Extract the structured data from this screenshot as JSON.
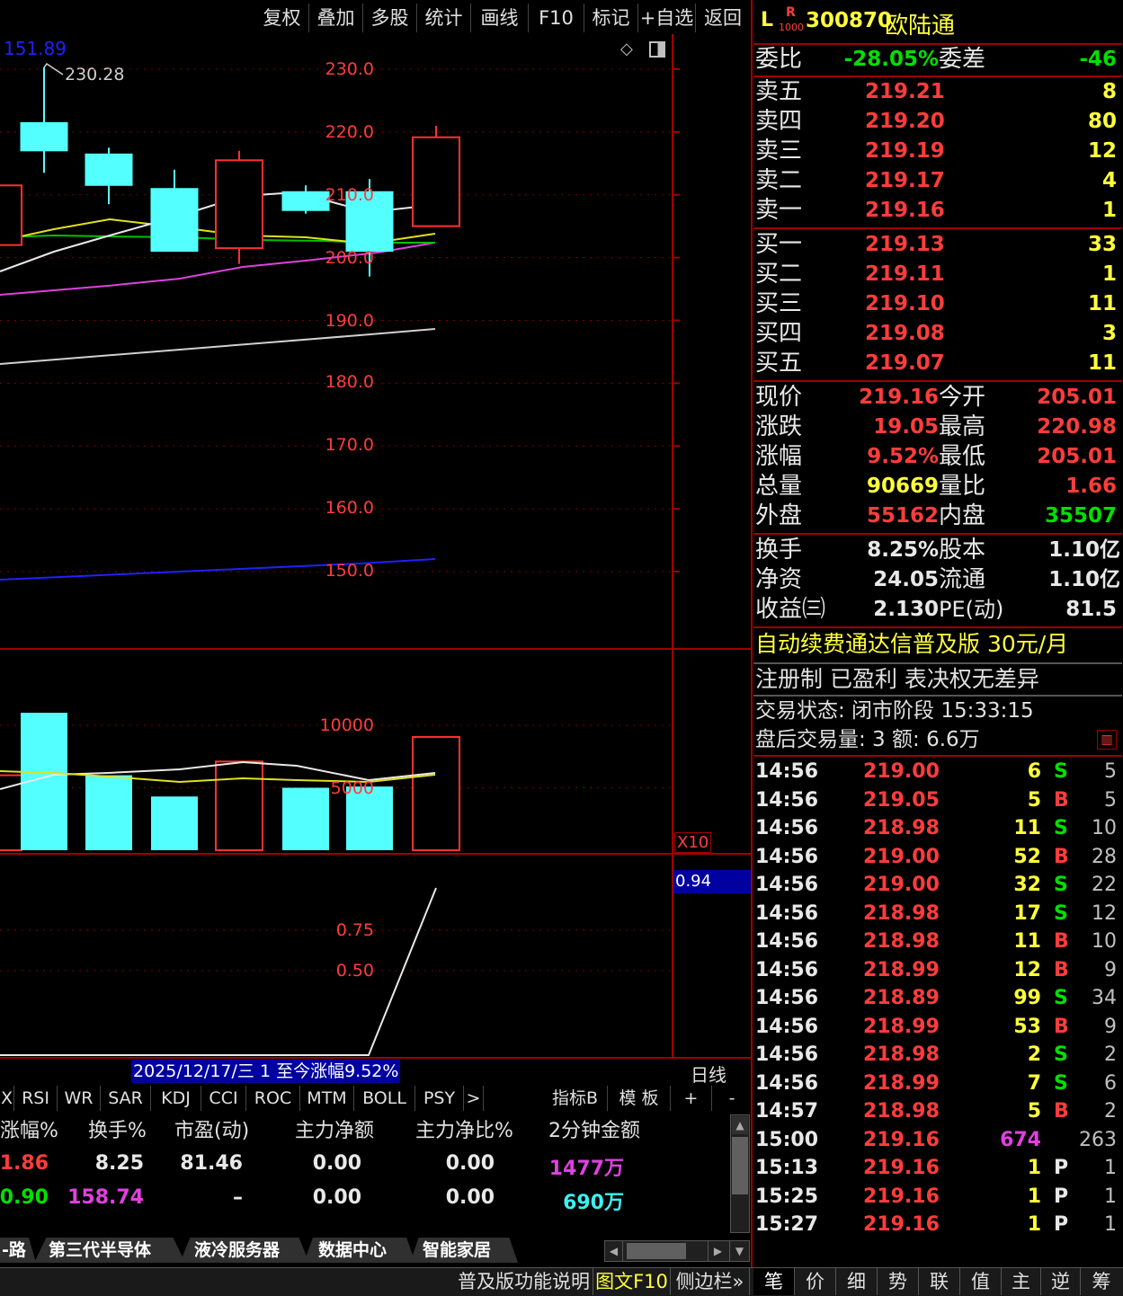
{
  "toolbar": {
    "items": [
      "复权",
      "叠加",
      "多股",
      "统计",
      "画线",
      "F10",
      "标记",
      "+自选",
      "返回"
    ]
  },
  "chart": {
    "ma_label": "151.89",
    "high_label": "230.28",
    "price_axis": [
      "230.0",
      "220.0",
      "210.0",
      "200.0",
      "190.0",
      "180.0",
      "170.0",
      "160.0",
      "150.0"
    ],
    "volume_axis": [
      "10000",
      "5000"
    ],
    "volume_unit": "X10",
    "ind_axis": [
      "0.94",
      "0.75",
      "0.50"
    ],
    "status_bar": "2025/12/17/三 1 至今涨幅9.52%",
    "period": "日线"
  },
  "chart_data": {
    "type": "candlestick",
    "ylim": [
      145,
      234
    ],
    "candles": [
      {
        "open": 211.5,
        "close": 202,
        "high": 215,
        "low": 199,
        "color": "red"
      },
      {
        "open": 221.5,
        "close": 217,
        "high": 230.28,
        "low": 213.5,
        "color": "cyan"
      },
      {
        "open": 216.5,
        "close": 211.5,
        "high": 217.5,
        "low": 208.5,
        "color": "cyan"
      },
      {
        "open": 211,
        "close": 201,
        "high": 214,
        "low": 201,
        "color": "cyan"
      },
      {
        "open": 201.5,
        "close": 215.5,
        "high": 217,
        "low": 199,
        "color": "red"
      },
      {
        "open": 210.5,
        "close": 207.5,
        "high": 211.5,
        "low": 207,
        "color": "cyan"
      },
      {
        "open": 210.5,
        "close": 201,
        "high": 212.5,
        "low": 197,
        "color": "cyan"
      },
      {
        "open": 205.01,
        "close": 219.16,
        "high": 220.98,
        "low": 205.01,
        "color": "red"
      }
    ],
    "volume": [
      {
        "value": 6000,
        "color": "red"
      },
      {
        "value": 11000,
        "color": "cyan"
      },
      {
        "value": 6000,
        "color": "cyan"
      },
      {
        "value": 4300,
        "color": "cyan"
      },
      {
        "value": 7100,
        "color": "red"
      },
      {
        "value": 5000,
        "color": "cyan"
      },
      {
        "value": 5100,
        "color": "cyan"
      },
      {
        "value": 9066.9,
        "color": "red"
      }
    ]
  },
  "indicator_tabs": [
    "X",
    "RSI",
    "WR",
    "SAR",
    "KDJ",
    "CCI",
    "ROC",
    "MTM",
    "BOLL",
    "PSY",
    ">",
    "指标B",
    "模 板",
    "+",
    "-"
  ],
  "table": {
    "headers": [
      "涨幅%",
      "换手%",
      "市盈(动)",
      "主力净额",
      "主力净比%",
      "2分钟金额"
    ],
    "rows": [
      [
        "1.86",
        "8.25",
        "81.46",
        "0.00",
        "0.00",
        "1477万"
      ],
      [
        "-0.90",
        "158.74",
        "–",
        "0.00",
        "0.00",
        "690万"
      ]
    ]
  },
  "sector_tabs": [
    "-路",
    "第三代半导体",
    "液冷服务器",
    "数据中心",
    "智能家居"
  ],
  "bottom_bar": [
    "普及版功能说明",
    "图文F10",
    "侧边栏»"
  ],
  "quote": {
    "market_tag": "L",
    "badge": "R",
    "badge_sub": "1000",
    "code": "300870",
    "name": "欧陆通",
    "weibi_label": "委比",
    "weibi": "-28.05%",
    "weicha_label": "委差",
    "weicha": "-46",
    "sells": [
      {
        "label": "卖五",
        "price": "219.21",
        "vol": "8"
      },
      {
        "label": "卖四",
        "price": "219.20",
        "vol": "80"
      },
      {
        "label": "卖三",
        "price": "219.19",
        "vol": "12"
      },
      {
        "label": "卖二",
        "price": "219.17",
        "vol": "4"
      },
      {
        "label": "卖一",
        "price": "219.16",
        "vol": "1"
      }
    ],
    "buys": [
      {
        "label": "买一",
        "price": "219.13",
        "vol": "33"
      },
      {
        "label": "买二",
        "price": "219.11",
        "vol": "1"
      },
      {
        "label": "买三",
        "price": "219.10",
        "vol": "11"
      },
      {
        "label": "买四",
        "price": "219.08",
        "vol": "3"
      },
      {
        "label": "买五",
        "price": "219.07",
        "vol": "11"
      }
    ],
    "stats": [
      {
        "l1": "现价",
        "v1": "219.16",
        "l2": "今开",
        "v2": "205.01"
      },
      {
        "l1": "涨跌",
        "v1": "19.05",
        "l2": "最高",
        "v2": "220.98"
      },
      {
        "l1": "涨幅",
        "v1": "9.52%",
        "l2": "最低",
        "v2": "205.01"
      },
      {
        "l1": "总量",
        "v1": "90669",
        "l2": "量比",
        "v2": "1.66"
      },
      {
        "l1": "外盘",
        "v1": "55162",
        "l2": "内盘",
        "v2": "35507"
      }
    ],
    "stats2": [
      {
        "l1": "换手",
        "v1": "8.25%",
        "l2": "股本",
        "v2": "1.10亿"
      },
      {
        "l1": "净资",
        "v1": "24.05",
        "l2": "流通",
        "v2": "1.10亿"
      },
      {
        "l1": "收益㈢",
        "v1": "2.130",
        "l2": "PE(动)",
        "v2": "81.5"
      }
    ],
    "promo": "自动续费通达信普及版 30元/月",
    "reg_info": "注册制 已盈利 表决权无差异",
    "trade_status": "交易状态: 闭市阶段 15:33:15",
    "after_hours": "盘后交易量: 3  额: 6.6万"
  },
  "ticks": [
    [
      "14:56",
      "219.00",
      "6",
      "S",
      "5"
    ],
    [
      "14:56",
      "219.05",
      "5",
      "B",
      "5"
    ],
    [
      "14:56",
      "218.98",
      "11",
      "S",
      "10"
    ],
    [
      "14:56",
      "219.00",
      "52",
      "B",
      "28"
    ],
    [
      "14:56",
      "219.00",
      "32",
      "S",
      "22"
    ],
    [
      "14:56",
      "218.98",
      "17",
      "S",
      "12"
    ],
    [
      "14:56",
      "218.98",
      "11",
      "B",
      "10"
    ],
    [
      "14:56",
      "218.99",
      "12",
      "B",
      "9"
    ],
    [
      "14:56",
      "218.89",
      "99",
      "S",
      "34"
    ],
    [
      "14:56",
      "218.99",
      "53",
      "B",
      "9"
    ],
    [
      "14:56",
      "218.98",
      "2",
      "S",
      "2"
    ],
    [
      "14:56",
      "218.99",
      "7",
      "S",
      "6"
    ],
    [
      "14:57",
      "218.98",
      "5",
      "B",
      "2"
    ],
    [
      "15:00",
      "219.16",
      "674",
      "",
      "263"
    ],
    [
      "15:13",
      "219.16",
      "1",
      "P",
      "1"
    ],
    [
      "15:25",
      "219.16",
      "1",
      "P",
      "1"
    ],
    [
      "15:27",
      "219.16",
      "1",
      "P",
      "1"
    ]
  ],
  "right_tabs": [
    "笔",
    "价",
    "细",
    "势",
    "联",
    "值",
    "主",
    "逆",
    "筹"
  ]
}
